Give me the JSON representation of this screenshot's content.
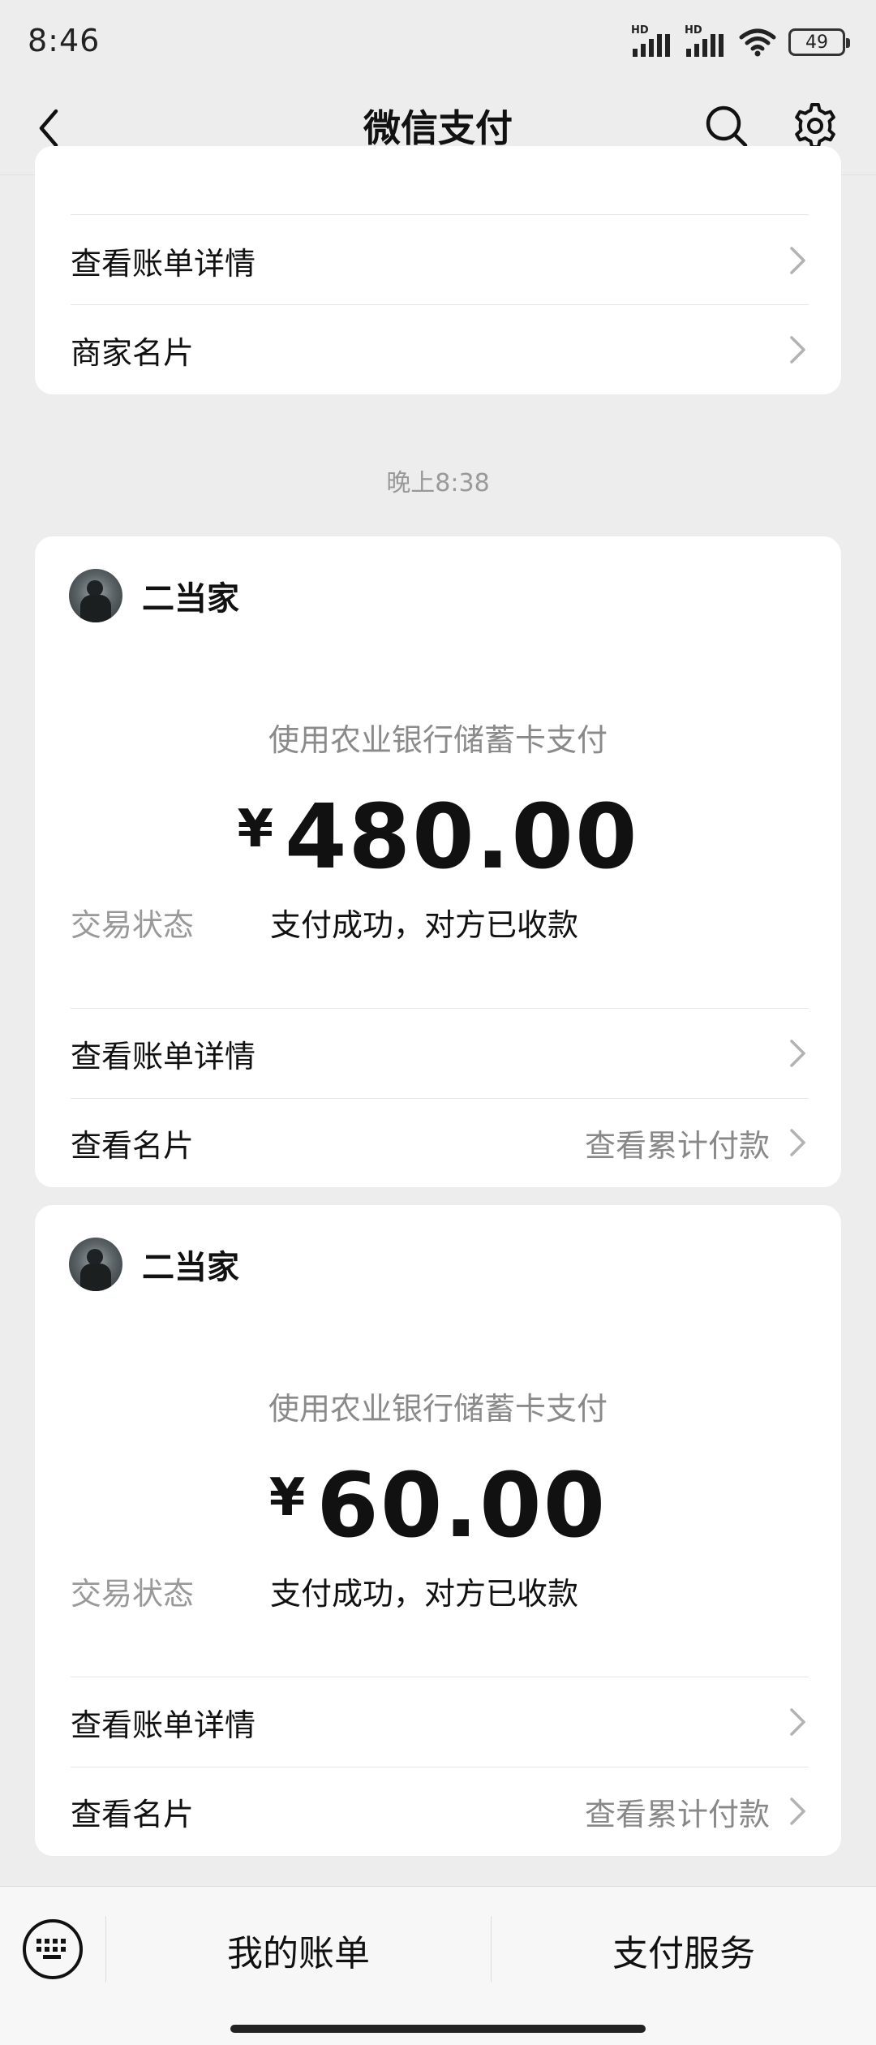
{
  "status_bar": {
    "time": "8:46",
    "sim1_label": "HD",
    "sim2_label": "HD",
    "battery": "49"
  },
  "header": {
    "title": "微信支付",
    "icons": [
      "back-arrow-icon",
      "search-icon",
      "gear-icon"
    ]
  },
  "partial_card": {
    "rows": [
      {
        "label": "查看账单详情"
      },
      {
        "label": "商家名片"
      }
    ]
  },
  "timestamp": "晚上8:38",
  "payments": [
    {
      "merchant": "二当家",
      "method": "使用农业银行储蓄卡支付",
      "currency": "¥",
      "amount": "480.00",
      "status_key": "交易状态",
      "status_value": "支付成功，对方已收款",
      "bill_detail_label": "查看账单详情",
      "card_label": "查看名片",
      "card_extra": "查看累计付款"
    },
    {
      "merchant": "二当家",
      "method": "使用农业银行储蓄卡支付",
      "currency": "¥",
      "amount": "60.00",
      "status_key": "交易状态",
      "status_value": "支付成功，对方已收款",
      "bill_detail_label": "查看账单详情",
      "card_label": "查看名片",
      "card_extra": "查看累计付款"
    }
  ],
  "bottom_bar": {
    "tabs": [
      {
        "label": "我的账单"
      },
      {
        "label": "支付服务"
      }
    ],
    "colors": {
      "background": "#f7f7f7",
      "page_background": "#ededed"
    }
  }
}
